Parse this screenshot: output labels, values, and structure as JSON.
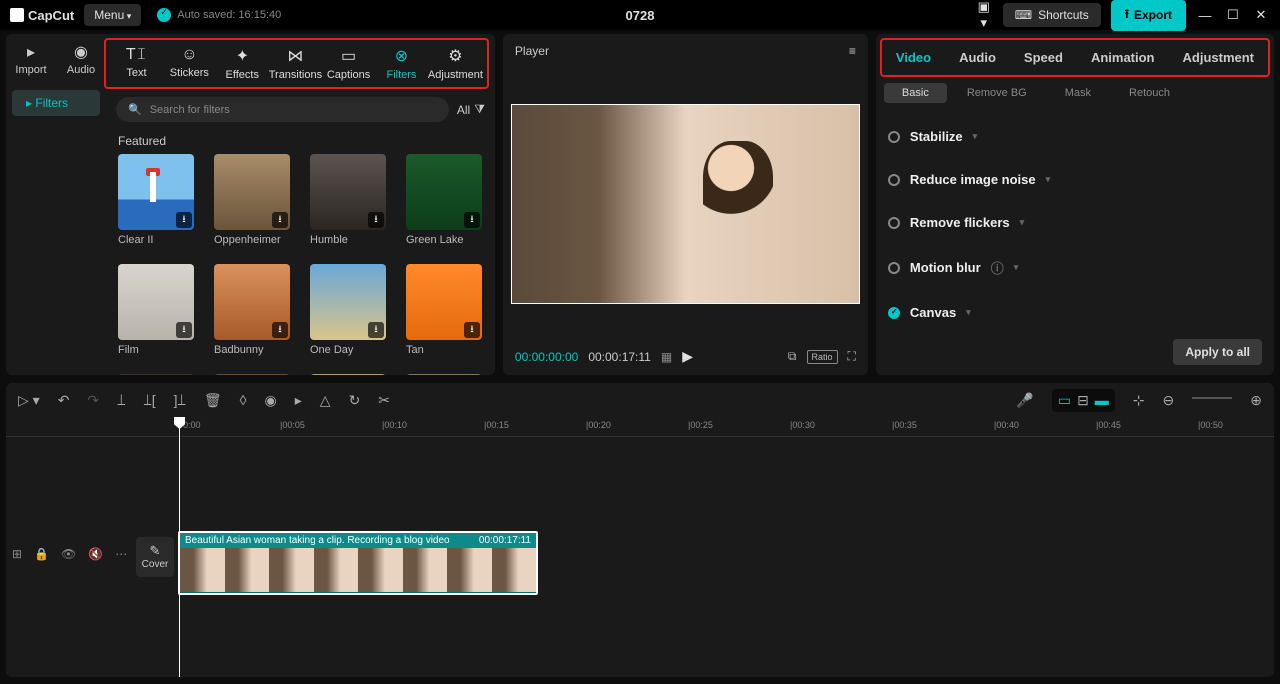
{
  "app": {
    "name": "CapCut",
    "menu_label": "Menu",
    "autosave": "Auto saved: 16:15:40",
    "project_title": "0728"
  },
  "topbar": {
    "shortcuts": "Shortcuts",
    "export": "Export"
  },
  "media_tabs": {
    "import": "Import",
    "audio": "Audio"
  },
  "tool_tabs": [
    "Text",
    "Stickers",
    "Effects",
    "Transitions",
    "Captions",
    "Filters",
    "Adjustment"
  ],
  "tool_tabs_active": "Filters",
  "sidebar": {
    "active": "Filters"
  },
  "search": {
    "placeholder": "Search for filters",
    "all_label": "All"
  },
  "featured_label": "Featured",
  "filters": [
    {
      "name": "Clear II",
      "cls": "t-clear"
    },
    {
      "name": "Oppenheimer",
      "cls": "t-opp"
    },
    {
      "name": "Humble",
      "cls": "t-humble"
    },
    {
      "name": "Green Lake",
      "cls": "t-green"
    },
    {
      "name": "Film",
      "cls": "t-film"
    },
    {
      "name": "Badbunny",
      "cls": "t-bad"
    },
    {
      "name": "One Day",
      "cls": "t-one"
    },
    {
      "name": "Tan",
      "cls": "t-tan"
    }
  ],
  "player": {
    "label": "Player",
    "current": "00:00:00:00",
    "duration": "00:00:17:11",
    "ratio": "Ratio"
  },
  "inspector": {
    "tabs": [
      "Video",
      "Audio",
      "Speed",
      "Animation",
      "Adjustment"
    ],
    "active": "Video",
    "subtabs": [
      "Basic",
      "Remove BG",
      "Mask",
      "Retouch"
    ],
    "sub_active": "Basic",
    "rows": [
      {
        "label": "Stabilize",
        "on": false
      },
      {
        "label": "Reduce image noise",
        "on": false
      },
      {
        "label": "Remove flickers",
        "on": false
      },
      {
        "label": "Motion blur",
        "on": false,
        "info": true
      },
      {
        "label": "Canvas",
        "on": true
      }
    ],
    "apply": "Apply to all"
  },
  "timeline": {
    "marks": [
      "00:00",
      "|00:05",
      "|00:10",
      "|00:15",
      "|00:20",
      "|00:25",
      "|00:30",
      "|00:35",
      "|00:40",
      "|00:45",
      "|00:50"
    ],
    "cover": "Cover",
    "clip": {
      "title": "Beautiful Asian woman taking a clip. Recording a blog video",
      "dur": "00:00:17:11"
    }
  }
}
